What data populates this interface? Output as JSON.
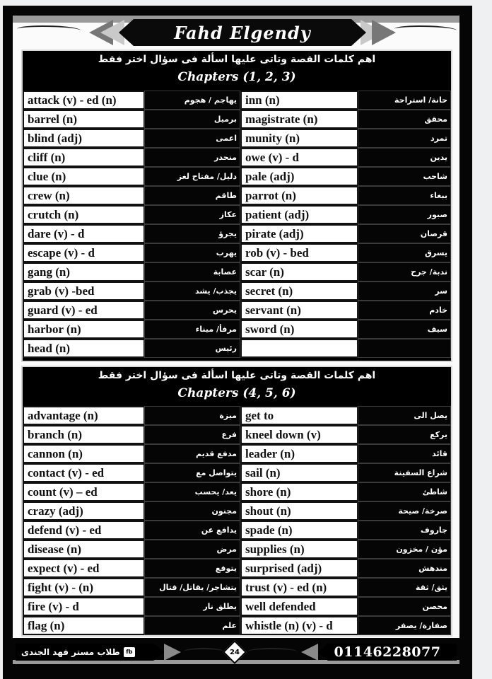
{
  "header": {
    "title": "Fahd Elgendy"
  },
  "sections": [
    {
      "heading": "اهم كلمات القصة وتاتى عليها اسألة فى سؤال اختر فقط",
      "chapters": "Chapters (1, 2, 3)",
      "rows": [
        {
          "en1": "attack (v) - ed (n)",
          "ar1": "يهاجم / هجوم",
          "en2": "inn (n)",
          "ar2": "حانة/ استراحة"
        },
        {
          "en1": "barrel (n)",
          "ar1": "برميل",
          "en2": "magistrate (n)",
          "ar2": "محقق"
        },
        {
          "en1": "blind (adj)",
          "ar1": "اعمى",
          "en2": "munity (n)",
          "ar2": "تمرد"
        },
        {
          "en1": "cliff (n)",
          "ar1": "منحدر",
          "en2": "owe (v) - d",
          "ar2": "يدين"
        },
        {
          "en1": "clue (n)",
          "ar1": "دليل/ مفتاح لغز",
          "en2": "pale (adj)",
          "ar2": "شاحب"
        },
        {
          "en1": "crew (n)",
          "ar1": "طاقم",
          "en2": "parrot (n)",
          "ar2": "ببغاء"
        },
        {
          "en1": "crutch (n)",
          "ar1": "عكاز",
          "en2": "patient (adj)",
          "ar2": "صبور"
        },
        {
          "en1": "dare (v) - d",
          "ar1": "يجرؤ",
          "en2": "pirate (adj)",
          "ar2": "قرصان"
        },
        {
          "en1": "escape (v) - d",
          "ar1": "يهرب",
          "en2": "rob (v) - bed",
          "ar2": "يسرق"
        },
        {
          "en1": "gang (n)",
          "ar1": "عصابة",
          "en2": "scar (n)",
          "ar2": "ندبة/ جرح"
        },
        {
          "en1": "grab (v) -bed",
          "ar1": "يجذب/ يشد",
          "en2": "secret (n)",
          "ar2": "سر"
        },
        {
          "en1": "guard (v) - ed",
          "ar1": "يحرس",
          "en2": "servant (n)",
          "ar2": "خادم"
        },
        {
          "en1": "harbor (n)",
          "ar1": "مرفأ/ ميناء",
          "en2": "sword (n)",
          "ar2": "سيف"
        },
        {
          "en1": "head (n)",
          "ar1": "رئيس",
          "en2": "",
          "ar2": ""
        }
      ]
    },
    {
      "heading": "اهم كلمات القصة وتاتى عليها اسألة فى سؤال اختر فقط",
      "chapters": "Chapters (4, 5, 6)",
      "rows": [
        {
          "en1": "advantage (n)",
          "ar1": "ميزة",
          "en2": "get to",
          "ar2": "يصل الى"
        },
        {
          "en1": "branch (n)",
          "ar1": "فرع",
          "en2": "kneel down (v)",
          "ar2": "يركع"
        },
        {
          "en1": "cannon (n)",
          "ar1": "مدفع قديم",
          "en2": "leader (n)",
          "ar2": "قائد"
        },
        {
          "en1": "contact (v) - ed",
          "ar1": "يتواصل مع",
          "en2": "sail (n)",
          "ar2": "شراع السفينة"
        },
        {
          "en1": "count (v) – ed",
          "ar1": "يعد/ يحسب",
          "en2": "shore (n)",
          "ar2": "شاطئ"
        },
        {
          "en1": "crazy (adj)",
          "ar1": "مجنون",
          "en2": "shout (n)",
          "ar2": "صرخة/ صيحة"
        },
        {
          "en1": "defend (v) - ed",
          "ar1": "يدافع عن",
          "en2": "spade (n)",
          "ar2": "جاروف"
        },
        {
          "en1": "disease (n)",
          "ar1": "مرض",
          "en2": "supplies (n)",
          "ar2": "مؤن / مخزون"
        },
        {
          "en1": "expect (v) - ed",
          "ar1": "يتوقع",
          "en2": "surprised (adj)",
          "ar2": "مندهش"
        },
        {
          "en1": "fight (v) - (n)",
          "ar1": "يتشاجر/ يقاتل/ قتال",
          "en2": "trust (v) - ed (n)",
          "ar2": "يثق/ ثقة"
        },
        {
          "en1": "fire (v) - d",
          "ar1": "يطلق نار",
          "en2": "well defended",
          "ar2": "محصن"
        },
        {
          "en1": "flag (n)",
          "ar1": "علم",
          "en2": "whistle (n) (v) - d",
          "ar2": "صفارة/ يصفر"
        }
      ]
    }
  ],
  "footer": {
    "left_text": "طلاب مستر فهد الجندى",
    "badge_icon": "facebook-group-icon",
    "page_number": "24",
    "phone": "01146228077"
  }
}
